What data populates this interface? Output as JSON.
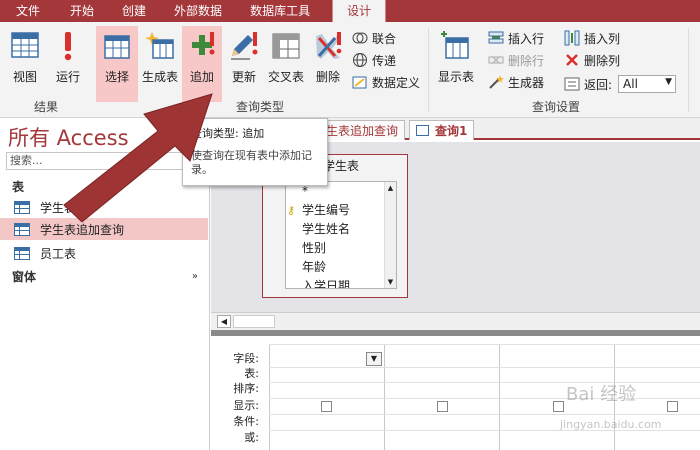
{
  "tabs": [
    "文件",
    "开始",
    "创建",
    "外部数据",
    "数据库工具",
    "设计"
  ],
  "ribbon": {
    "view": "视图",
    "run": "运行",
    "select": "选择",
    "make_table": "生成表",
    "append": "追加",
    "update": "更新",
    "crosstab": "交叉表",
    "delete": "删除",
    "union": "联合",
    "passthrough": "传递",
    "data_def": "数据定义",
    "show_table": "显示表",
    "insert_row": "插入行",
    "delete_row": "删除行",
    "builder": "生成器",
    "insert_col": "插入列",
    "delete_col": "删除列",
    "return_label": "返回:",
    "return_value": "All",
    "group_results": "结果",
    "group_query_type": "查询类型",
    "group_query_setup": "查询设置"
  },
  "nav": {
    "title": "所有 Access",
    "search_placeholder": "搜索...",
    "section_tables": "表",
    "section_forms": "窗体",
    "items": [
      "学生表",
      "学生表追加查询",
      "员工表"
    ]
  },
  "doc_tabs": [
    "学生表追加查询",
    "查询1"
  ],
  "table_box": {
    "title": "学生表",
    "fields": [
      "*",
      "学生编号",
      "学生姓名",
      "性别",
      "年龄",
      "入学日期"
    ]
  },
  "grid": {
    "row_labels": [
      "字段:",
      "表:",
      "排序:",
      "显示:",
      "条件:",
      "或:"
    ]
  },
  "tooltip": {
    "title": "查询类型: 追加",
    "desc": "使查询在现有表中添加记录。"
  },
  "watermark": {
    "main": "Bai 经验",
    "sub": "jingyan.baidu.com"
  },
  "colors": {
    "accent": "#a4373a",
    "arrow": "#9e3433"
  }
}
